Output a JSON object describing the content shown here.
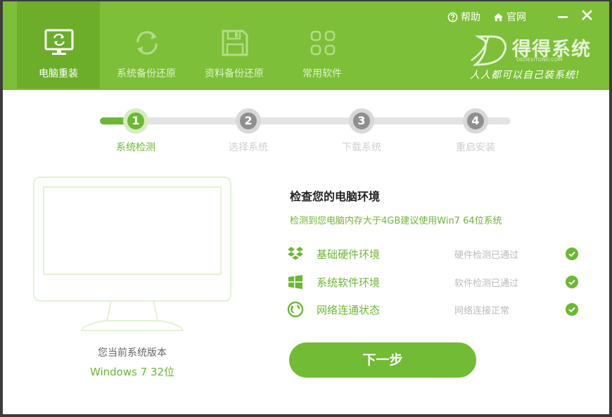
{
  "header": {
    "help_label": "帮助",
    "site_label": "官网",
    "tabs": [
      {
        "label": "电脑重装",
        "icon": "monitor-refresh-icon",
        "active": true
      },
      {
        "label": "系统备份还原",
        "icon": "refresh-icon",
        "active": false
      },
      {
        "label": "资料备份还原",
        "icon": "floppy-disk-icon",
        "active": false
      },
      {
        "label": "常用软件",
        "icon": "apps-grid-icon",
        "active": false
      }
    ],
    "brand": {
      "name": "得得系统",
      "url": "DEDEXITONG.COM",
      "slogan": "人人都可以自己装系统!"
    }
  },
  "steps": [
    {
      "number": "1",
      "label": "系统检测",
      "active": true
    },
    {
      "number": "2",
      "label": "选择系统",
      "active": false
    },
    {
      "number": "3",
      "label": "下载系统",
      "active": false
    },
    {
      "number": "4",
      "label": "重启安装",
      "active": false
    }
  ],
  "left_panel": {
    "version_label": "您当前系统版本",
    "version_value": "Windows 7 32位"
  },
  "check": {
    "title": "检查您的电脑环境",
    "subtitle": "检测到您电脑内存大于4GB建议使用Win7 64位系统",
    "items": [
      {
        "name": "基础硬件环境",
        "status": "硬件检测已通过",
        "icon": "dropbox-icon"
      },
      {
        "name": "系统软件环境",
        "status": "软件检测已通过",
        "icon": "windows-logo-icon"
      },
      {
        "name": "网络连通状态",
        "status": "网络连接正常",
        "icon": "globe-icon"
      }
    ]
  },
  "next_button_label": "下一步",
  "colors": {
    "header_green": "#7dbf38",
    "active_tab_green": "#6cae2a",
    "accent_green": "#6cb832",
    "inactive_gray": "#8f8f8f"
  }
}
